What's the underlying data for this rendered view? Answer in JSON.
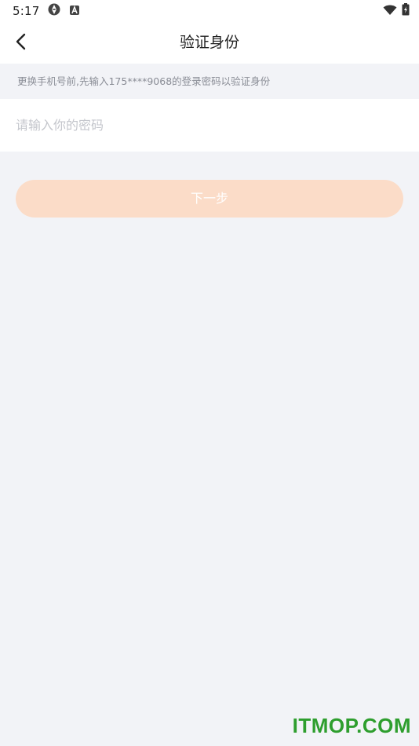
{
  "status_bar": {
    "time": "5:17",
    "icons": [
      "sync-icon",
      "app-notification-icon",
      "wifi-icon",
      "battery-charging-icon"
    ]
  },
  "header": {
    "title": "验证身份",
    "back_icon": "chevron-left-icon"
  },
  "hint": {
    "text": "更换手机号前,先输入175****9068的登录密码以验证身份"
  },
  "password_input": {
    "value": "",
    "placeholder": "请输入你的密码"
  },
  "next_button": {
    "label": "下一步",
    "color": "#fbdcc8",
    "enabled": false
  },
  "watermark": {
    "text": "ITMOP.COM",
    "color": "#2e9e2e"
  },
  "colors": {
    "background": "#f2f3f7",
    "surface": "#ffffff",
    "hint_text": "#8a8d96",
    "placeholder": "#c4c6cc"
  }
}
